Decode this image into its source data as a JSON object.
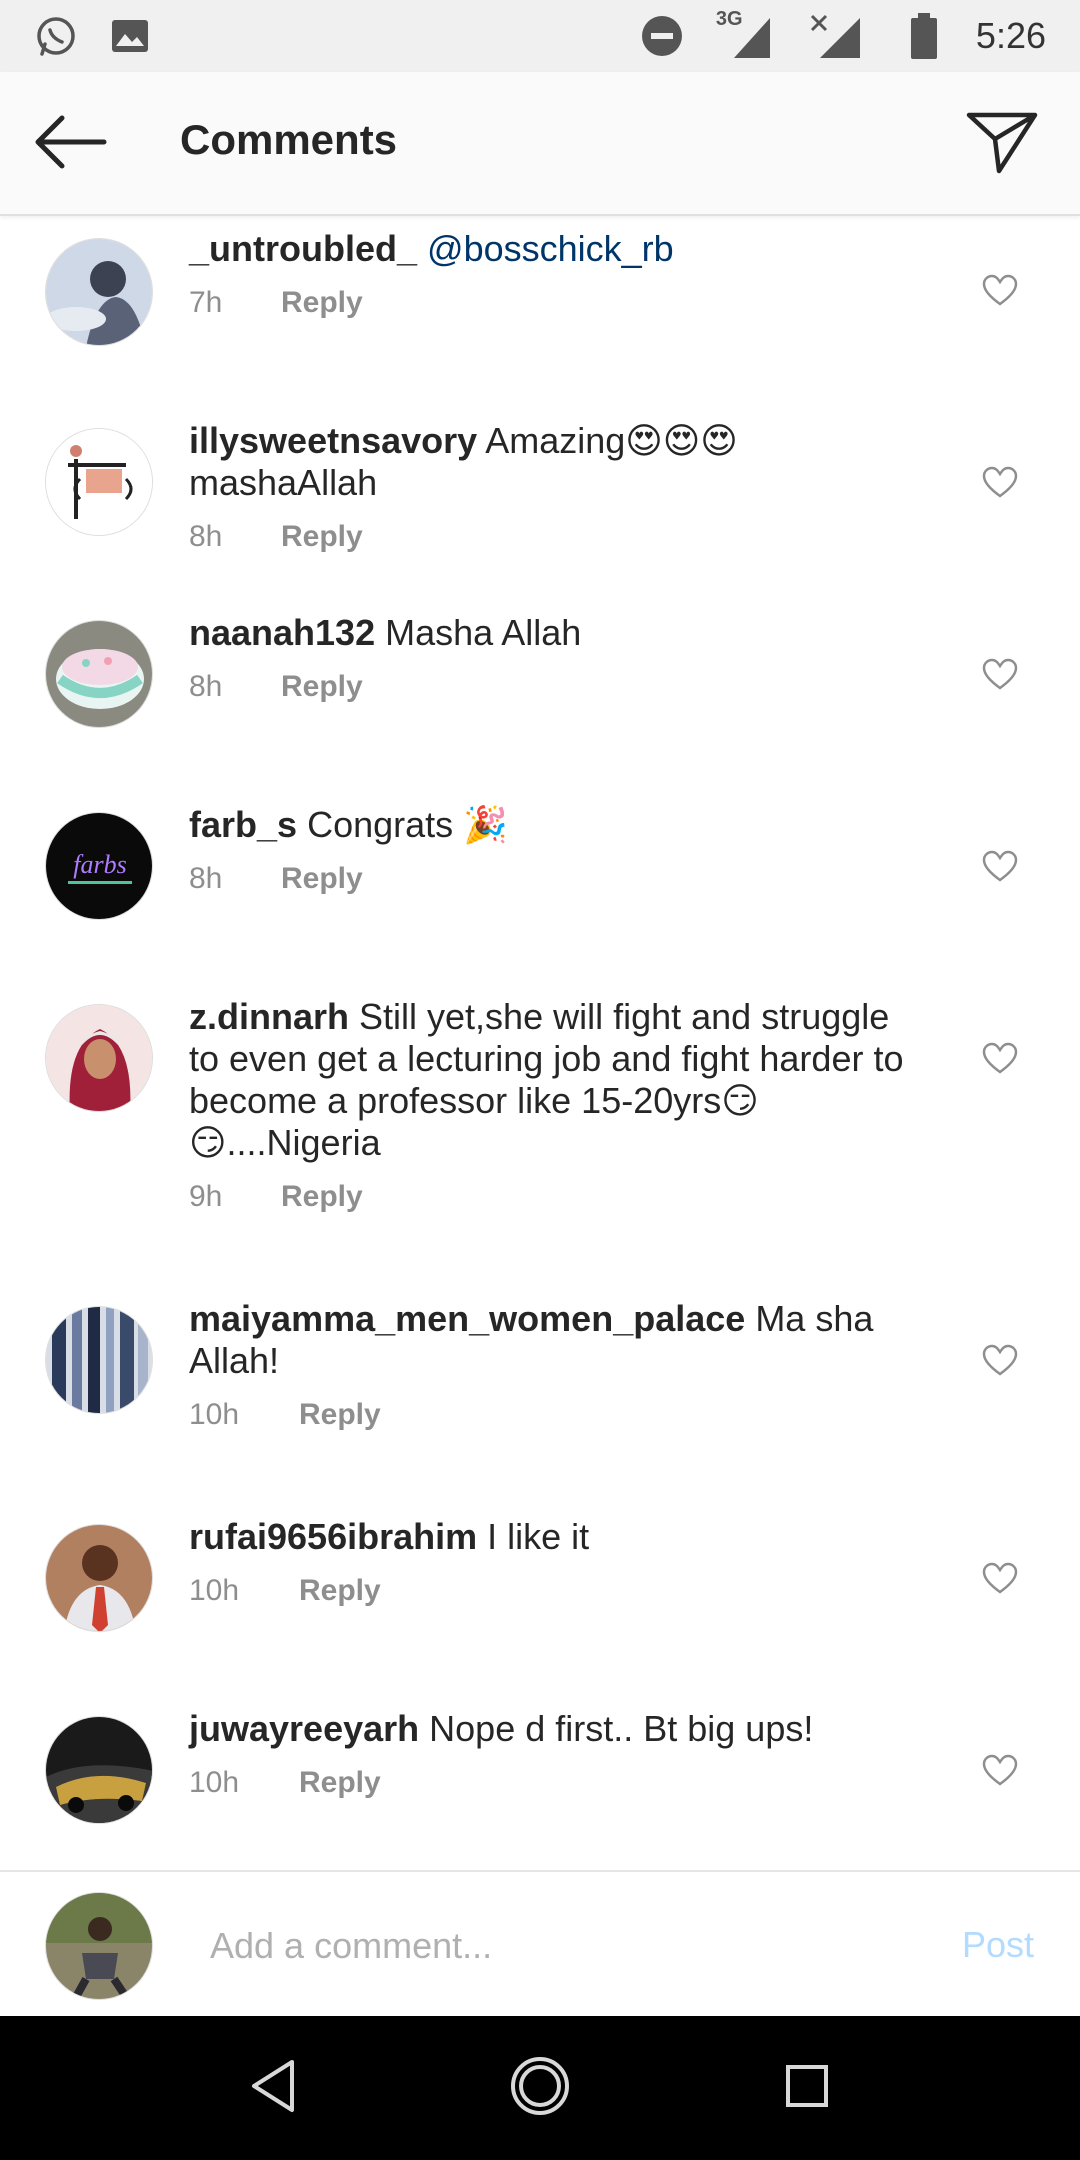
{
  "status_bar": {
    "time": "5:26",
    "network": "3G",
    "icons": [
      "whatsapp-icon",
      "gallery-icon",
      "dnd-icon",
      "signal-icon",
      "no-signal-icon",
      "battery-icon"
    ]
  },
  "header": {
    "title": "Comments",
    "back_icon": "arrow-left-icon",
    "share_icon": "direct-send-icon"
  },
  "comments": [
    {
      "username": "_untroubled_",
      "mention": "@bosschick_rb",
      "text": "",
      "time": "7h",
      "reply_label": "Reply",
      "avatar_colors": [
        "#cfd8e6",
        "#5a6278"
      ]
    },
    {
      "username": "illysweetnsavory",
      "text": "Amazing😍😍😍mashaAllah",
      "time": "8h",
      "reply_label": "Reply",
      "avatar_colors": [
        "#ffffff",
        "#e8a48c"
      ]
    },
    {
      "username": "naanah132",
      "text": "Masha Allah",
      "time": "8h",
      "reply_label": "Reply",
      "avatar_colors": [
        "#d8dcd8",
        "#88d4c4"
      ]
    },
    {
      "username": "farb_s",
      "text": "Congrats 🎉",
      "time": "8h",
      "reply_label": "Reply",
      "avatar_colors": [
        "#0a0a0a",
        "#b07cff"
      ]
    },
    {
      "username": "z.dinnarh",
      "text": "Still yet,she will fight and struggle to even get a lecturing job and fight harder to become a professor like 15-20yrs😏😏....Nigeria",
      "time": "9h",
      "reply_label": "Reply",
      "avatar_colors": [
        "#f4e4e4",
        "#a0203a"
      ]
    },
    {
      "username": "maiyamma_men_women_palace",
      "text": "Ma sha Allah!",
      "time": "10h",
      "reply_label": "Reply",
      "avatar_colors": [
        "#2a3a5a",
        "#d9dde6"
      ]
    },
    {
      "username": "rufai9656ibrahim",
      "text": "I like it",
      "time": "10h",
      "reply_label": "Reply",
      "avatar_colors": [
        "#b08060",
        "#6a4030"
      ]
    },
    {
      "username": "juwayreeyarh",
      "text": "Nope d first.. Bt big ups!",
      "time": "10h",
      "reply_label": "Reply",
      "avatar_colors": [
        "#1a1a1a",
        "#c8a040"
      ]
    }
  ],
  "composer": {
    "placeholder": "Add a comment...",
    "post_label": "Post"
  },
  "nav": {
    "buttons": [
      "back-triangle-icon",
      "home-circle-icon",
      "recents-square-icon"
    ]
  },
  "colors": {
    "link": "#003569",
    "meta": "#8e8e8e",
    "post_disabled": "#b3dbff"
  }
}
